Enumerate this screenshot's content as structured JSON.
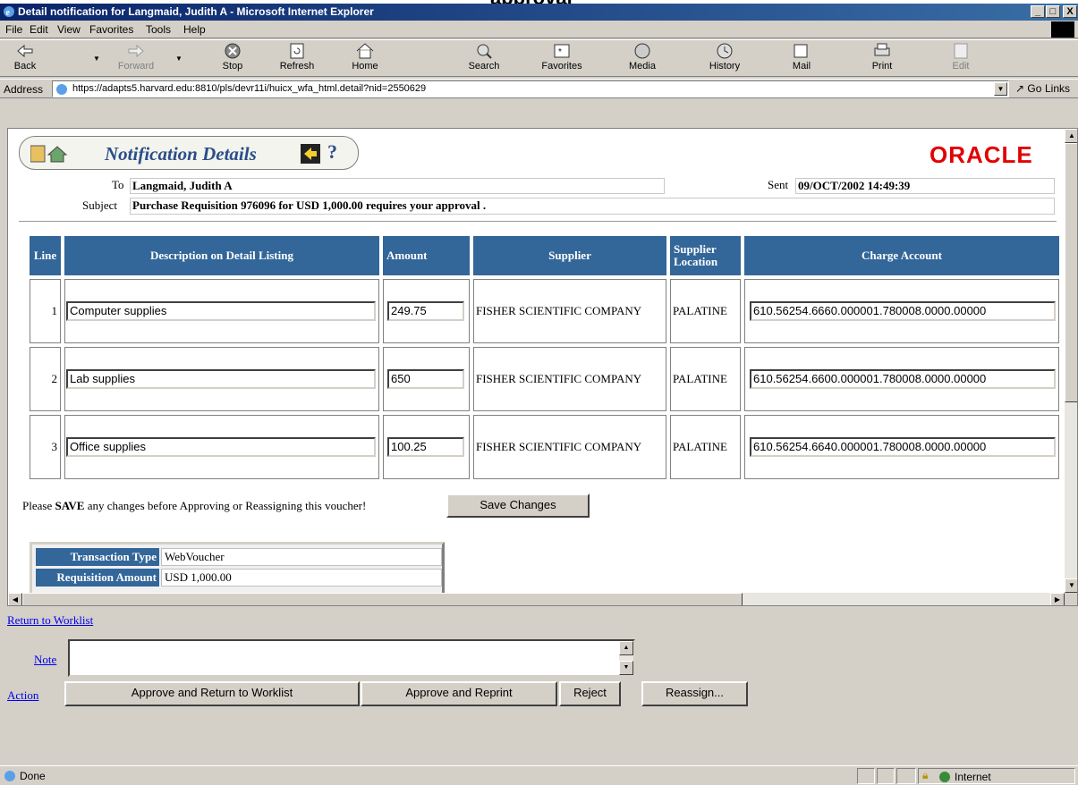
{
  "window": {
    "title": "Detail notification for Langmaid, Judith A - Microsoft Internet Explorer",
    "min": "_",
    "max": "□",
    "close": "X"
  },
  "menu": [
    "File",
    "Edit",
    "View",
    "Favorites",
    "Tools",
    "Help"
  ],
  "toolbar": {
    "back": "Back",
    "forward": "Forward",
    "stop": "Stop",
    "refresh": "Refresh",
    "home": "Home",
    "search": "Search",
    "favorites": "Favorites",
    "media": "Media",
    "history": "History",
    "mail": "Mail",
    "print": "Print",
    "edit": "Edit"
  },
  "address": {
    "label": "Address",
    "url": "https://adapts5.harvard.edu:8810/pls/devr11i/huicx_wfa_html.detail?nid=2550629",
    "go": "Go",
    "links": "Links"
  },
  "notification": {
    "title": "Notification Details",
    "help": "?",
    "logo": "ORACLE",
    "to_label": "To",
    "to_value": "Langmaid, Judith A",
    "sent_label": "Sent",
    "sent_value": "09/OCT/2002 14:49:39",
    "subject_label": "Subject",
    "subject_value": "Purchase Requisition 976096 for USD 1,000.00 requires your approval ."
  },
  "table": {
    "headers": {
      "line": "Line",
      "description": "Description on Detail Listing",
      "amount": "Amount",
      "supplier": "Supplier",
      "supplier_location_1": "Supplier",
      "supplier_location_2": "Location",
      "charge_account": "Charge Account"
    },
    "rows": [
      {
        "line": "1",
        "description": "Computer supplies",
        "amount": "249.75",
        "supplier": "FISHER SCIENTIFIC COMPANY",
        "location": "PALATINE",
        "account": "610.56254.6660.000001.780008.0000.00000"
      },
      {
        "line": "2",
        "description": "Lab supplies",
        "amount": "650",
        "supplier": "FISHER SCIENTIFIC COMPANY",
        "location": "PALATINE",
        "account": "610.56254.6600.000001.780008.0000.00000"
      },
      {
        "line": "3",
        "description": "Office supplies",
        "amount": "100.25",
        "supplier": "FISHER SCIENTIFIC COMPANY",
        "location": "PALATINE",
        "account": "610.56254.6640.000001.780008.0000.00000"
      }
    ]
  },
  "save": {
    "prefix": "Please",
    "bold": "SAVE",
    "suffix": "any changes before Approving or Reassigning this voucher!",
    "button": "Save Changes"
  },
  "transaction": {
    "type_label": "Transaction Type",
    "type_value": "WebVoucher",
    "amount_label": "Requisition Amount",
    "amount_value": "USD 1,000.00"
  },
  "bottom": {
    "return_link": "Return to Worklist",
    "note_label": "Note",
    "action_label": "Action",
    "approve_return": "Approve and Return to Worklist",
    "approve_reprint": "Approve and Reprint",
    "reject": "Reject",
    "reassign": "Reassign..."
  },
  "status": {
    "text": "Done",
    "zone": "Internet"
  },
  "colors": {
    "header_blue": "#336699",
    "title_blue": "#2a4e8a",
    "oracle_red": "#e20000",
    "link_blue": "#0000ee"
  }
}
